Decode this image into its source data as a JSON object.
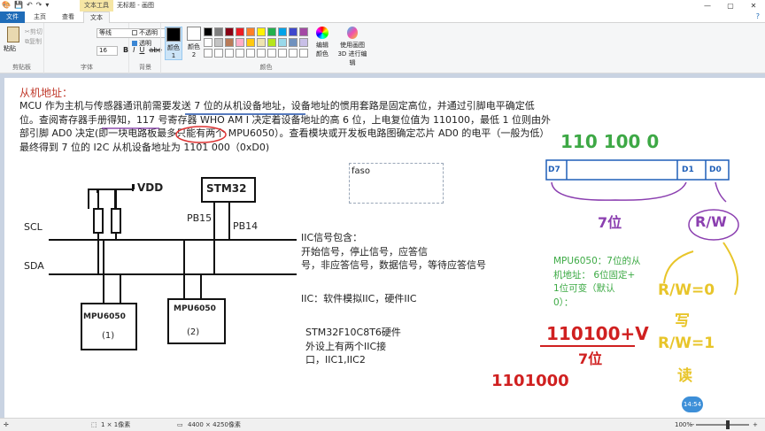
{
  "titlebar": {
    "context_tab": "文本工具",
    "title": "无标题 - 画图",
    "buttons": [
      "—",
      "▢",
      "✕"
    ]
  },
  "tabs": {
    "file": "文件",
    "home": "主页",
    "view": "查看",
    "text": "文本"
  },
  "ribbon": {
    "clipboard": {
      "paste": "粘贴",
      "cut": "剪切",
      "copy": "复制",
      "label": "剪贴板"
    },
    "font": {
      "family": "等线",
      "size": "16",
      "bold": "B",
      "italic": "I",
      "underline": "U",
      "strike": "abc",
      "label": "字体"
    },
    "background": {
      "opaque": "不透明",
      "transparent": "透明",
      "label": "背景"
    },
    "colors": {
      "color1_label": "颜色 1",
      "color2_label": "颜色 2",
      "color1": "#000000",
      "color2": "#ffffff",
      "palette": [
        "#000000",
        "#7f7f7f",
        "#880015",
        "#ed1c24",
        "#ff7f27",
        "#fff200",
        "#22b14c",
        "#00a2e8",
        "#3f48cc",
        "#a349a4",
        "#ffffff",
        "#c3c3c3",
        "#b97a57",
        "#ffaec9",
        "#ffc90e",
        "#efe4b0",
        "#b5e61d",
        "#99d9ea",
        "#7092be",
        "#c8bfe7",
        "#ffffff",
        "#ffffff",
        "#ffffff",
        "#ffffff",
        "#ffffff",
        "#ffffff",
        "#ffffff",
        "#ffffff",
        "#ffffff",
        "#ffffff"
      ],
      "edit": "编辑颜色",
      "paint3d": "使用画图 3D 进行编辑",
      "label": "颜色"
    }
  },
  "canvas": {
    "heading": "从机地址：",
    "paragraph": "MCU 作为主机与传感器通讯前需要发送 7 位的从机设备地址，设备地址的惯用套路是固定高位，并通过引脚电平确定低位。查阅寄存器手册得知，117 号寄存器 WHO AM I 决定着设备地址的高 6 位，上电复位值为 110100，最低 1 位则由外部引脚 AD0 决定(即一块电路板最多只能有两个 MPU6050）。查看模块或开发板电路图确定芯片 AD0 的电平（一般为低）最终得到 7 位的 I2C 从机设备地址为 1101 000（0xD0)",
    "textbox_value": "faso",
    "iic_signals": "IIC信号包含：\n开始信号，停止信号，应答信\n号，非应答信号，数据信号，等待应答信号",
    "iic_types": "IIC：软件模拟IIC，硬件IIC",
    "stm32": "STM32F10C8T6硬件\n外设上有两个IIC接\n口，IIC1,IIC2",
    "mpu_note": "MPU6050：7位的从\n机地址： 6位固定+\n1位可变（默认\n0）：",
    "diagram": {
      "vdd": "VDD",
      "stm32": "STM32",
      "pb15": "PB15",
      "pb14": "PB14",
      "scl": "SCL",
      "sda": "SDA",
      "chip1": "MPU6050",
      "chip1_num": "(1)",
      "chip2": "MPU6050",
      "chip2_num": "(2)"
    },
    "hand": {
      "bits": "110 100 0",
      "d7": "D7",
      "d1": "D1",
      "d0": "D0",
      "seven_bits": "7位",
      "rw": "R/W",
      "rw0": "R/W=0",
      "write": "写",
      "rw1": "R/W=1",
      "read": "读",
      "addr_plus_v": "110100+V",
      "seven_bits2": "7位",
      "bits2": "1101000"
    }
  },
  "status": {
    "cursor": "",
    "selection": "1 × 1像素",
    "size": "4400 × 4250像素",
    "zoom": "100%",
    "zoom_minus": "−",
    "zoom_plus": "+",
    "time": "14:54"
  }
}
